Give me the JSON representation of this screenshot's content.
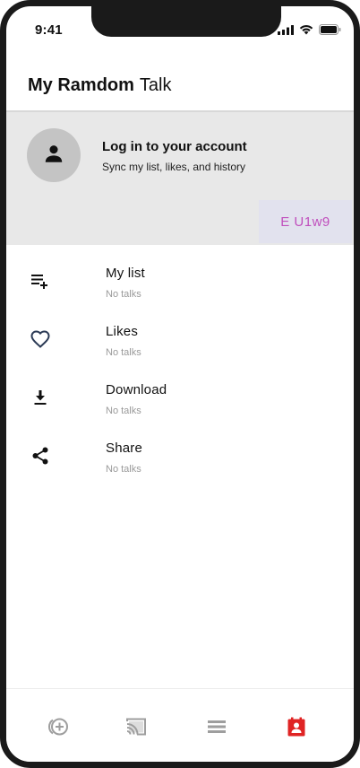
{
  "status_bar": {
    "time": "9:41",
    "icons": [
      "cellular-signal-icon",
      "wifi-icon",
      "battery-icon"
    ]
  },
  "header": {
    "title_bold": "My Ramdom",
    "title_regular": "Talk"
  },
  "account": {
    "avatar_icon": "person-icon",
    "title": "Log in to your account",
    "subtitle": "Sync my list, likes, and history",
    "code": "E U1w9"
  },
  "menu": {
    "items": [
      {
        "icon": "playlist-add-icon",
        "label": "My list",
        "sub": "No talks"
      },
      {
        "icon": "heart-outline-icon",
        "label": "Likes",
        "sub": "No talks"
      },
      {
        "icon": "download-icon",
        "label": "Download",
        "sub": "No talks"
      },
      {
        "icon": "share-icon",
        "label": "Share",
        "sub": "No talks"
      }
    ]
  },
  "tabbar": {
    "tabs": [
      {
        "icon": "discover-icon",
        "active": false
      },
      {
        "icon": "cast-icon",
        "active": false
      },
      {
        "icon": "list-icon",
        "active": false
      },
      {
        "icon": "profile-icon",
        "active": true
      }
    ],
    "active_color": "#e02424",
    "inactive_color": "#9e9e9e"
  },
  "colors": {
    "account_bg": "#e8e8e8",
    "code_text": "#c04fbd",
    "code_bg": "#e2e2ee"
  }
}
